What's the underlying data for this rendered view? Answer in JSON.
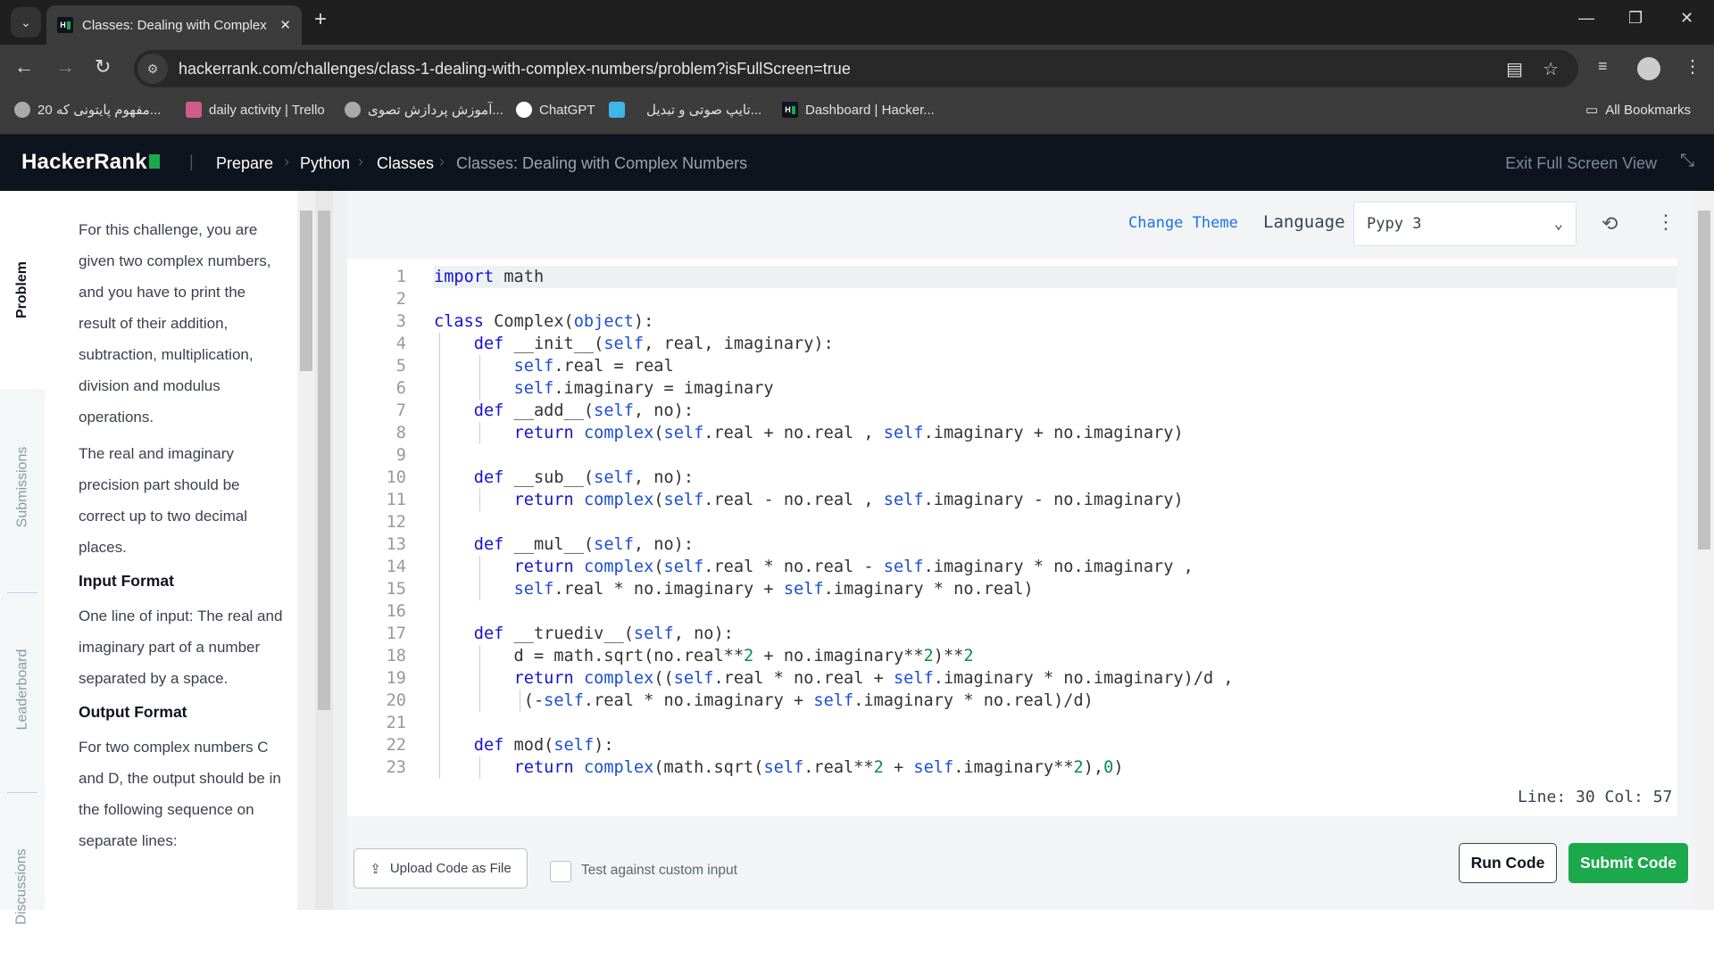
{
  "browser": {
    "tab_title": "Classes: Dealing with Complex Numbers",
    "url": "hackerrank.com/challenges/class-1-dealing-with-complex-numbers/problem?isFullScreen=true",
    "bookmarks": [
      "20 مفهوم پایتونی که...",
      "daily activity | Trello",
      "آموزش پردازش تصوی...",
      "ChatGPT",
      "",
      "تایپ صوتی و تبدیل...",
      "Dashboard | Hacker..."
    ],
    "all_bookmarks": "All Bookmarks"
  },
  "header": {
    "logo": "HackerRank",
    "crumbs": [
      "Prepare",
      "Python",
      "Classes",
      "Classes: Dealing with Complex Numbers"
    ],
    "exit_fullscreen": "Exit Full Screen View"
  },
  "vtabs": [
    "Problem",
    "Submissions",
    "Leaderboard",
    "Discussions"
  ],
  "problem": {
    "p1": "For this challenge, you are given two complex numbers, and you have to print the result of their addition, subtraction, multiplication, division and modulus operations.",
    "p2": "The real and imaginary precision part should be correct up to two decimal places.",
    "h_input": "Input Format",
    "p3": "One line of input: The real and imaginary part of a number separated by a space.",
    "h_output": "Output Format",
    "p4": "For two complex numbers C and D, the output should be in the following sequence on separate lines:"
  },
  "editor": {
    "change_theme": "Change Theme",
    "language_label": "Language",
    "language": "Pypy 3",
    "status": "Line: 30 Col: 57",
    "lines": [
      [
        [
          "kw",
          "import"
        ],
        [
          "t",
          " math"
        ]
      ],
      [],
      [
        [
          "kw",
          "class"
        ],
        [
          "t",
          " Complex("
        ],
        [
          "bi",
          "object"
        ],
        [
          "t",
          "):"
        ]
      ],
      [
        [
          "t",
          "    "
        ],
        [
          "kw",
          "def"
        ],
        [
          "t",
          " __init__("
        ],
        [
          "bi",
          "self"
        ],
        [
          "t",
          ", real, imaginary):"
        ]
      ],
      [
        [
          "t",
          "        "
        ],
        [
          "bi",
          "self"
        ],
        [
          "t",
          ".real = real"
        ]
      ],
      [
        [
          "t",
          "        "
        ],
        [
          "bi",
          "self"
        ],
        [
          "t",
          ".imaginary = imaginary"
        ]
      ],
      [
        [
          "t",
          "    "
        ],
        [
          "kw",
          "def"
        ],
        [
          "t",
          " __add__("
        ],
        [
          "bi",
          "self"
        ],
        [
          "t",
          ", no):"
        ]
      ],
      [
        [
          "t",
          "        "
        ],
        [
          "kw",
          "return"
        ],
        [
          "t",
          " "
        ],
        [
          "bi",
          "complex"
        ],
        [
          "t",
          "("
        ],
        [
          "bi",
          "self"
        ],
        [
          "t",
          ".real + no.real , "
        ],
        [
          "bi",
          "self"
        ],
        [
          "t",
          ".imaginary + no.imaginary)"
        ]
      ],
      [],
      [
        [
          "t",
          "    "
        ],
        [
          "kw",
          "def"
        ],
        [
          "t",
          " __sub__("
        ],
        [
          "bi",
          "self"
        ],
        [
          "t",
          ", no):"
        ]
      ],
      [
        [
          "t",
          "        "
        ],
        [
          "kw",
          "return"
        ],
        [
          "t",
          " "
        ],
        [
          "bi",
          "complex"
        ],
        [
          "t",
          "("
        ],
        [
          "bi",
          "self"
        ],
        [
          "t",
          ".real - no.real , "
        ],
        [
          "bi",
          "self"
        ],
        [
          "t",
          ".imaginary - no.imaginary)"
        ]
      ],
      [],
      [
        [
          "t",
          "    "
        ],
        [
          "kw",
          "def"
        ],
        [
          "t",
          " __mul__("
        ],
        [
          "bi",
          "self"
        ],
        [
          "t",
          ", no):"
        ]
      ],
      [
        [
          "t",
          "        "
        ],
        [
          "kw",
          "return"
        ],
        [
          "t",
          " "
        ],
        [
          "bi",
          "complex"
        ],
        [
          "t",
          "("
        ],
        [
          "bi",
          "self"
        ],
        [
          "t",
          ".real * no.real - "
        ],
        [
          "bi",
          "self"
        ],
        [
          "t",
          ".imaginary * no.imaginary ,"
        ]
      ],
      [
        [
          "t",
          "        "
        ],
        [
          "bi",
          "self"
        ],
        [
          "t",
          ".real * no.imaginary + "
        ],
        [
          "bi",
          "self"
        ],
        [
          "t",
          ".imaginary * no.real)"
        ]
      ],
      [],
      [
        [
          "t",
          "    "
        ],
        [
          "kw",
          "def"
        ],
        [
          "t",
          " __truediv__("
        ],
        [
          "bi",
          "self"
        ],
        [
          "t",
          ", no):"
        ]
      ],
      [
        [
          "t",
          "        d = math.sqrt(no.real**"
        ],
        [
          "num",
          "2"
        ],
        [
          "t",
          " + no.imaginary**"
        ],
        [
          "num",
          "2"
        ],
        [
          "t",
          ")**"
        ],
        [
          "num",
          "2"
        ]
      ],
      [
        [
          "t",
          "        "
        ],
        [
          "kw",
          "return"
        ],
        [
          "t",
          " "
        ],
        [
          "bi",
          "complex"
        ],
        [
          "t",
          "(("
        ],
        [
          "bi",
          "self"
        ],
        [
          "t",
          ".real * no.real + "
        ],
        [
          "bi",
          "self"
        ],
        [
          "t",
          ".imaginary * no.imaginary)/d ,"
        ]
      ],
      [
        [
          "t",
          "         (-"
        ],
        [
          "bi",
          "self"
        ],
        [
          "t",
          ".real * no.imaginary + "
        ],
        [
          "bi",
          "self"
        ],
        [
          "t",
          ".imaginary * no.real)/d)"
        ]
      ],
      [],
      [
        [
          "t",
          "    "
        ],
        [
          "kw",
          "def"
        ],
        [
          "t",
          " mod("
        ],
        [
          "bi",
          "self"
        ],
        [
          "t",
          "):"
        ]
      ],
      [
        [
          "t",
          "        "
        ],
        [
          "kw",
          "return"
        ],
        [
          "t",
          " "
        ],
        [
          "bi",
          "complex"
        ],
        [
          "t",
          "(math.sqrt("
        ],
        [
          "bi",
          "self"
        ],
        [
          "t",
          ".real**"
        ],
        [
          "num",
          "2"
        ],
        [
          "t",
          " + "
        ],
        [
          "bi",
          "self"
        ],
        [
          "t",
          ".imaginary**"
        ],
        [
          "num",
          "2"
        ],
        [
          "t",
          "),"
        ],
        [
          "num",
          "0"
        ],
        [
          "t",
          ")"
        ]
      ]
    ]
  },
  "footer": {
    "upload": "Upload Code as File",
    "custom_input": "Test against custom input",
    "run": "Run Code",
    "submit": "Submit Code"
  }
}
